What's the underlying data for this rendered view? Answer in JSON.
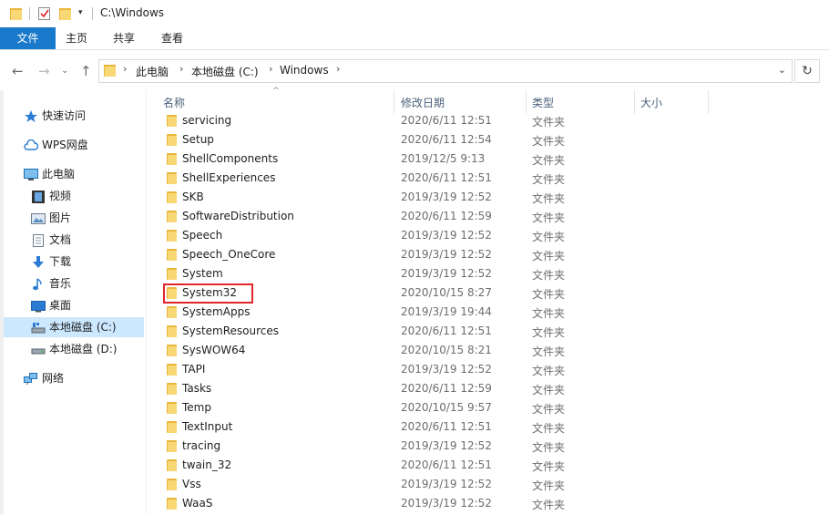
{
  "window": {
    "title": "C:\\Windows"
  },
  "ribbon": {
    "tabs": [
      "文件",
      "主页",
      "共享",
      "查看"
    ]
  },
  "address": {
    "crumbs": [
      "此电脑",
      "本地磁盘 (C:)",
      "Windows"
    ]
  },
  "nav": {
    "items": [
      {
        "label": "快速访问",
        "icon": "star-icon"
      },
      {
        "label": "WPS网盘",
        "icon": "cloud-icon"
      },
      {
        "label": "此电脑",
        "icon": "computer-icon"
      },
      {
        "label": "视频",
        "icon": "video-icon"
      },
      {
        "label": "图片",
        "icon": "picture-icon"
      },
      {
        "label": "文档",
        "icon": "document-icon"
      },
      {
        "label": "下载",
        "icon": "download-icon"
      },
      {
        "label": "音乐",
        "icon": "music-icon"
      },
      {
        "label": "桌面",
        "icon": "desktop-icon"
      },
      {
        "label": "本地磁盘 (C:)",
        "icon": "drive-icon"
      },
      {
        "label": "本地磁盘 (D:)",
        "icon": "drive-icon"
      },
      {
        "label": "网络",
        "icon": "network-icon"
      }
    ]
  },
  "columns": {
    "name": "名称",
    "date": "修改日期",
    "type": "类型",
    "size": "大小"
  },
  "files": [
    {
      "name": "servicing",
      "date": "2020/6/11 12:51",
      "type": "文件夹"
    },
    {
      "name": "Setup",
      "date": "2020/6/11 12:54",
      "type": "文件夹"
    },
    {
      "name": "ShellComponents",
      "date": "2019/12/5 9:13",
      "type": "文件夹"
    },
    {
      "name": "ShellExperiences",
      "date": "2020/6/11 12:51",
      "type": "文件夹"
    },
    {
      "name": "SKB",
      "date": "2019/3/19 12:52",
      "type": "文件夹"
    },
    {
      "name": "SoftwareDistribution",
      "date": "2020/6/11 12:59",
      "type": "文件夹"
    },
    {
      "name": "Speech",
      "date": "2019/3/19 12:52",
      "type": "文件夹"
    },
    {
      "name": "Speech_OneCore",
      "date": "2019/3/19 12:52",
      "type": "文件夹"
    },
    {
      "name": "System",
      "date": "2019/3/19 12:52",
      "type": "文件夹"
    },
    {
      "name": "System32",
      "date": "2020/10/15 8:27",
      "type": "文件夹"
    },
    {
      "name": "SystemApps",
      "date": "2019/3/19 19:44",
      "type": "文件夹"
    },
    {
      "name": "SystemResources",
      "date": "2020/6/11 12:51",
      "type": "文件夹"
    },
    {
      "name": "SysWOW64",
      "date": "2020/10/15 8:21",
      "type": "文件夹"
    },
    {
      "name": "TAPI",
      "date": "2019/3/19 12:52",
      "type": "文件夹"
    },
    {
      "name": "Tasks",
      "date": "2020/6/11 12:59",
      "type": "文件夹"
    },
    {
      "name": "Temp",
      "date": "2020/10/15 9:57",
      "type": "文件夹"
    },
    {
      "name": "TextInput",
      "date": "2020/6/11 12:51",
      "type": "文件夹"
    },
    {
      "name": "tracing",
      "date": "2019/3/19 12:52",
      "type": "文件夹"
    },
    {
      "name": "twain_32",
      "date": "2020/6/11 12:51",
      "type": "文件夹"
    },
    {
      "name": "Vss",
      "date": "2019/3/19 12:52",
      "type": "文件夹"
    },
    {
      "name": "WaaS",
      "date": "2019/3/19 12:52",
      "type": "文件夹"
    }
  ],
  "highlighted_file": "System32",
  "colors": {
    "accent": "#1979ca",
    "highlight": "#e0262b",
    "folder": "#f8d775",
    "selected_nav": "#cce8ff"
  }
}
